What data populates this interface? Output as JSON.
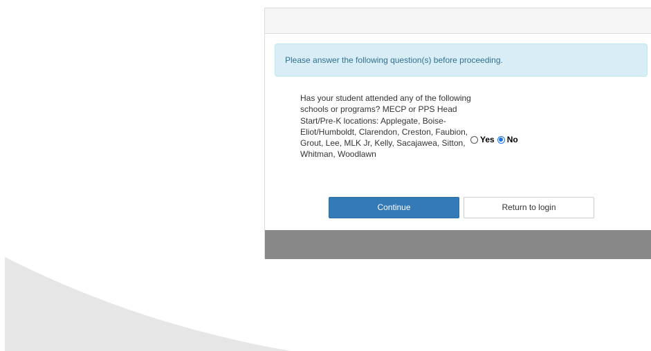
{
  "alert": {
    "message": "Please answer the following question(s) before proceeding."
  },
  "question": {
    "text": "Has your student attended any of the following schools or programs? MECP or PPS Head Start/Pre-K locations: Applegate, Boise-Eliot/Humboldt, Clarendon, Creston, Faubion, Grout, Lee, MLK Jr, Kelly, Sacajawea, Sitton, Whitman, Woodlawn",
    "options": [
      {
        "label": "Yes",
        "selected": false
      },
      {
        "label": "No",
        "selected": true
      }
    ]
  },
  "buttons": {
    "continue_label": "Continue",
    "return_label": "Return to login"
  },
  "colors": {
    "primary": "#337ab7",
    "alert_bg": "#d9edf7",
    "alert_text": "#31708f",
    "footer": "#888888",
    "radio_selected": "#1a73e8"
  }
}
